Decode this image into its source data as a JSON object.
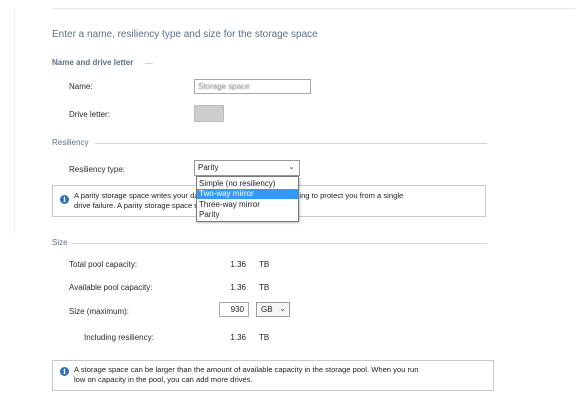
{
  "heading": "Enter a name, resiliency type and size for the storage space",
  "name_section": {
    "title": "Name and drive letter",
    "name_label": "Name:",
    "name_value": "Storage space",
    "drive_label": "Drive letter:"
  },
  "resiliency": {
    "title": "Resiliency",
    "type_label": "Resiliency type:",
    "selected": "Parity",
    "dropdown_open": true,
    "options": [
      {
        "label": "Simple (no resiliency)",
        "highlighted": false
      },
      {
        "label": "Two-way mirror",
        "highlighted": true
      },
      {
        "label": "Three-way mirror",
        "highlighted": false
      },
      {
        "label": "Parity",
        "highlighted": false
      }
    ],
    "info_line1": "A parity storage space writes your data with parity information, helping to protect you from a single",
    "info_line2": "drive failure. A parity storage space requires at least three drives."
  },
  "size": {
    "title": "Size",
    "total_label": "Total pool capacity:",
    "total_value": "1.36",
    "total_unit": "TB",
    "available_label": "Available pool capacity:",
    "available_value": "1.36",
    "available_unit": "TB",
    "max_label": "Size (maximum):",
    "max_value": "930",
    "max_unit": "GB",
    "including_label": "Including resiliency:",
    "including_value": "1.36",
    "including_unit": "TB",
    "info_line1": "A storage space can be larger than the amount of available capacity in the storage pool. When you run",
    "info_line2": "low on capacity in the pool, you can add more drives."
  },
  "colors": {
    "heading": "#5d6f86",
    "highlight": "#3399ff",
    "info_icon": "#2f6fb8"
  }
}
